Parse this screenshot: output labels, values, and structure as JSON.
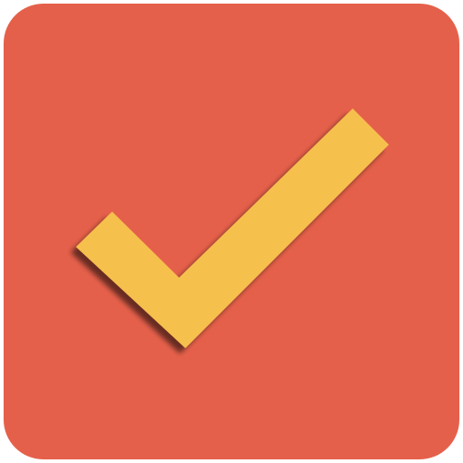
{
  "icon": {
    "name": "checkmark-icon",
    "tile_color": "#E5604A",
    "check_color": "#F6C04E",
    "shadow_color": "#5A1A10"
  }
}
